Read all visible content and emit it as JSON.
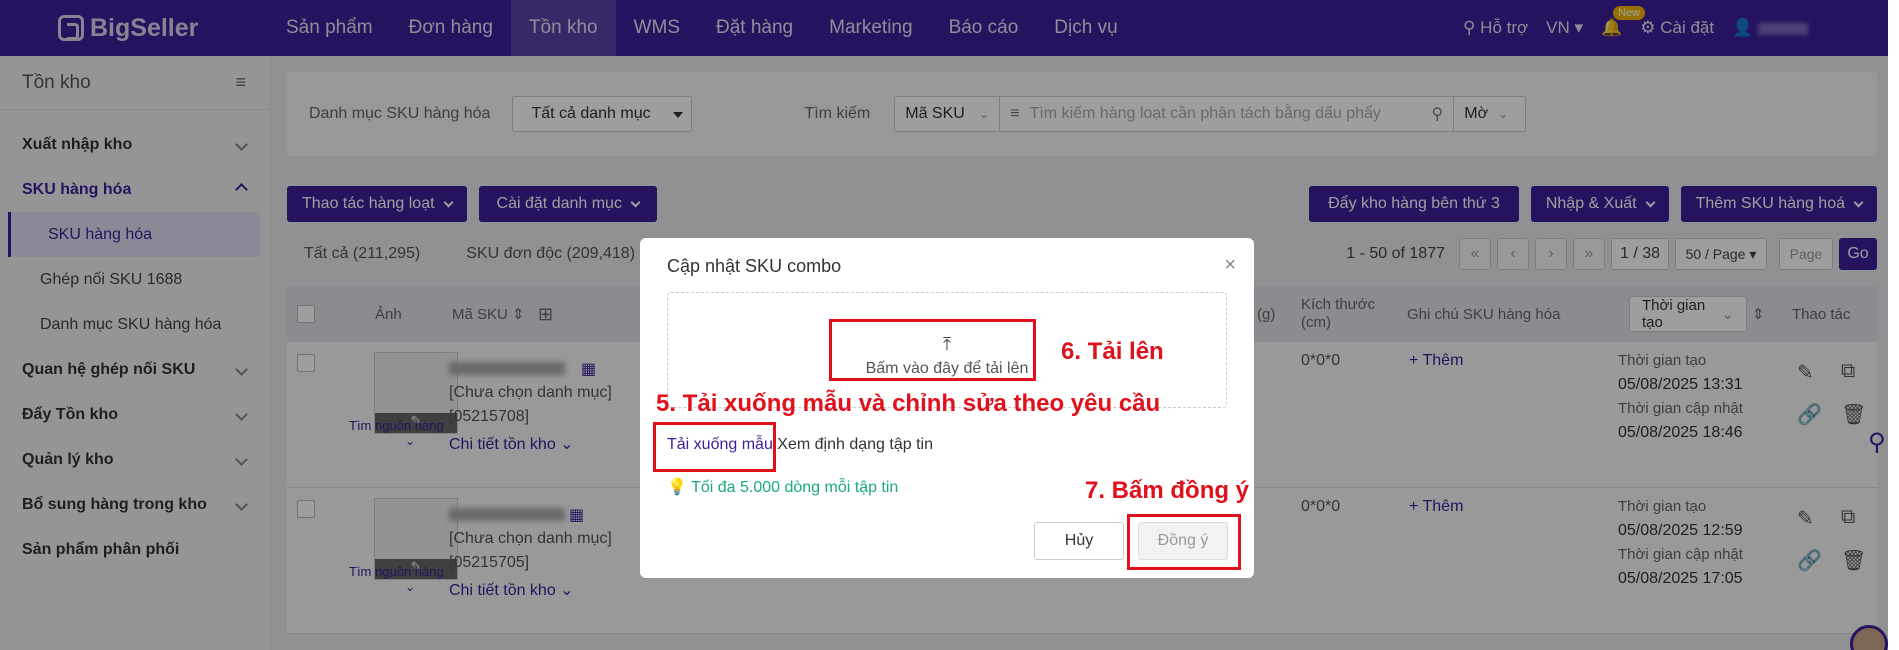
{
  "topbar": {
    "logo": "BigSeller",
    "nav": [
      "Sản phẩm",
      "Đơn hàng",
      "Tồn kho",
      "WMS",
      "Đặt hàng",
      "Marketing",
      "Báo cáo",
      "Dịch vụ"
    ],
    "help": "Hỗ trợ",
    "lang": "VN",
    "new_badge": "New",
    "settings": "Cài đặt"
  },
  "sidebar": {
    "title": "Tồn kho",
    "items": [
      {
        "label": "Xuất nhập kho"
      },
      {
        "label": "SKU hàng hóa"
      },
      {
        "label": "SKU hàng hóa"
      },
      {
        "label": "Ghép nối SKU 1688"
      },
      {
        "label": "Danh mục SKU hàng hóa"
      },
      {
        "label": "Quan hệ ghép nối SKU"
      },
      {
        "label": "Đẩy Tồn kho"
      },
      {
        "label": "Quản lý kho"
      },
      {
        "label": "Bổ sung hàng trong kho"
      },
      {
        "label": "Sản phẩm phân phối"
      }
    ]
  },
  "filter": {
    "category_label": "Danh mục SKU hàng hóa",
    "category_value": "Tất cả danh mục",
    "search_label": "Tìm kiếm",
    "search_type": "Mã SKU",
    "search_placeholder": "Tìm kiếm hàng loạt cần phân tách bằng dấu phẩy",
    "match": "Mờ"
  },
  "actions": {
    "bulk": "Thao tác hàng loạt",
    "category_settings": "Cài đặt danh mục",
    "push_3pl": "Đẩy kho hàng bên thứ 3",
    "import_export": "Nhập & Xuất",
    "add_sku": "Thêm SKU hàng hoá"
  },
  "counts": {
    "all": "Tất cả (211,295)",
    "single": "SKU đơn độc (209,418)"
  },
  "pager": {
    "range": "1 - 50 of 1877",
    "page": "1 / 38",
    "per_page": "50 / Page",
    "page_placeholder": "Page",
    "go": "Go"
  },
  "table": {
    "headers": {
      "image": "Ảnh",
      "sku": "Mã SKU",
      "weight": "(g)",
      "size": "Kích thước (cm)",
      "note": "Ghi chú SKU hàng hóa",
      "time": "Thời gian tạo",
      "ops": "Thao tác"
    },
    "rows": [
      {
        "category": "[Chưa chọn danh mục]",
        "id": "[05215708]",
        "source": "Tìm nguồn hàng",
        "detail": "Chi tiết tồn kho",
        "size": "0*0*0",
        "add": "+ Thêm",
        "created_label": "Thời gian tạo",
        "created": "05/08/2025 13:31",
        "updated_label": "Thời gian cập nhật",
        "updated": "05/08/2025 18:46"
      },
      {
        "category": "[Chưa chọn danh mục]",
        "id": "[05215705]",
        "source": "Tìm nguồn hàng",
        "detail": "Chi tiết tồn kho",
        "size": "0*0*0",
        "add": "+ Thêm",
        "created_label": "Thời gian tạo",
        "created": "05/08/2025 12:59",
        "updated_label": "Thời gian cập nhật",
        "updated": "05/08/2025 17:05"
      }
    ]
  },
  "modal": {
    "title": "Cập nhật SKU combo",
    "upload_text": "Bấm vào đây để tải lên",
    "download_template": "Tải xuống mẫu",
    "view_format": "Xem định dạng tập tin",
    "tip": "Tối đa 5.000 dòng mỗi tập tin",
    "cancel": "Hủy",
    "ok": "Đồng ý"
  },
  "annotations": {
    "step5": "5. Tải xuống mẫu và chỉnh sửa theo yêu cầu",
    "step6": "6. Tải lên",
    "step7": "7. Bấm đồng ý"
  },
  "colors": {
    "brand": "#3c1f9a",
    "annotation": "#e0101c",
    "tip": "#1aaa7f"
  }
}
